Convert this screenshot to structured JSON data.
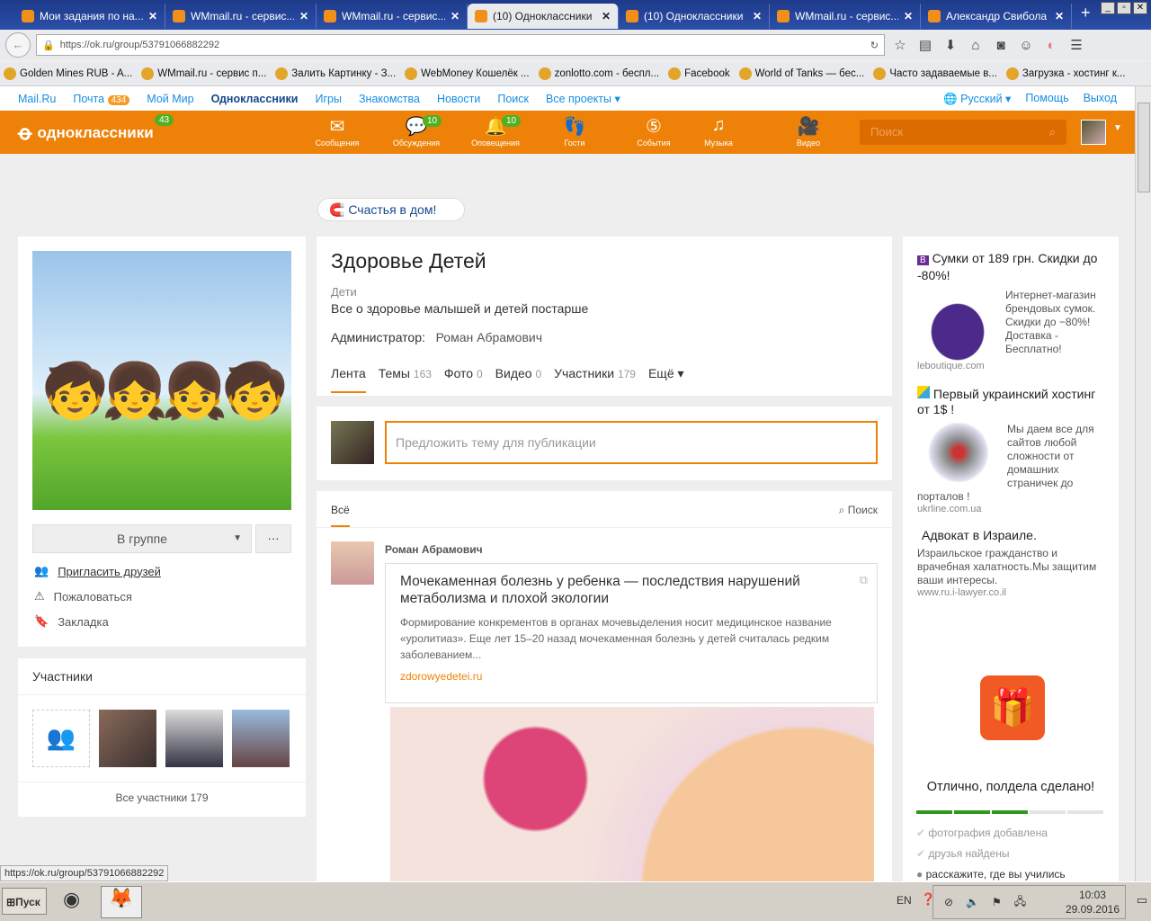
{
  "browser": {
    "tabs": [
      {
        "title": "Мои задания по на..."
      },
      {
        "title": "WMmail.ru - сервис..."
      },
      {
        "title": "WMmail.ru - сервис..."
      },
      {
        "title": "(10) Одноклассники",
        "active": true
      },
      {
        "title": "(10) Одноклассники"
      },
      {
        "title": "WMmail.ru - сервис..."
      },
      {
        "title": "Александр Свибола"
      }
    ],
    "url": "https://ok.ru/group/53791066882292",
    "bookmarks": [
      "Golden Mines RUB - A...",
      "WMmail.ru - сервис п...",
      "Залить Картинку - З...",
      "WebMoney Кошелёк ...",
      "zonlotto.com - беспл...",
      "Facebook",
      "World of Tanks — бес...",
      "Часто задаваемые в...",
      "Загрузка - хостинг к..."
    ],
    "status_url": "https://ok.ru/group/53791066882292"
  },
  "mailbar": {
    "items": [
      "Mail.Ru",
      "Почта",
      "Мой Мир",
      "Одноклассники",
      "Игры",
      "Знакомства",
      "Новости",
      "Поиск",
      "Все проекты ▾"
    ],
    "mail_count": "434",
    "lang": "Русский ▾",
    "help": "Помощь",
    "exit": "Выход"
  },
  "header": {
    "logo": "одноклассники",
    "logo_badge": "43",
    "nav": [
      {
        "label": "Сообщения",
        "icon": "envelope-icon",
        "glyph": "✉"
      },
      {
        "label": "Обсуждения",
        "icon": "chat-icon",
        "glyph": "💬",
        "badge": "10"
      },
      {
        "label": "Оповещения",
        "icon": "bell-icon",
        "glyph": "🔔",
        "badge": "10"
      },
      {
        "label": "Гости",
        "icon": "footprints-icon",
        "glyph": "👣"
      },
      {
        "label": "События",
        "icon": "events-icon",
        "glyph": "⑤"
      },
      {
        "label": "Музыка",
        "icon": "music-icon",
        "glyph": "♫"
      },
      {
        "label": "Видео",
        "icon": "video-icon",
        "glyph": "🎥"
      }
    ],
    "search_placeholder": "Поиск"
  },
  "promo": "Счастья в дом!",
  "left": {
    "group_button": "В группе",
    "more": "···",
    "actions": [
      "Пригласить друзей",
      "Пожаловаться",
      "Закладка"
    ],
    "members_title": "Участники",
    "all_members": "Все участники 179"
  },
  "group": {
    "title": "Здоровье Детей",
    "category": "Дети",
    "description": "Все о здоровье малышей и детей постарше",
    "admin_label": "Администратор:",
    "admin": "Роман Абрамович",
    "tabs": [
      {
        "label": "Лента",
        "count": ""
      },
      {
        "label": "Темы",
        "count": "163"
      },
      {
        "label": "Фото",
        "count": "0"
      },
      {
        "label": "Видео",
        "count": "0"
      },
      {
        "label": "Участники",
        "count": "179"
      },
      {
        "label": "Ещё ▾",
        "count": ""
      }
    ],
    "suggest_placeholder": "Предложить тему для публикации"
  },
  "feed": {
    "filter": "Всё",
    "search": "Поиск",
    "author": "Роман Абрамович",
    "post_title": "Мочекаменная болезнь у ребенка — последствия нарушений метаболизма и плохой экологии",
    "post_text": "Формирование конкрементов в органах мочевыделения носит медицинское название «уролитиаз». Еще лет 15–20 назад мочекаменная болезнь у детей считалась редким заболеванием...",
    "post_link": "zdorowyedetei.ru"
  },
  "ads": [
    {
      "title": "Сумки от 189 грн. Скидки до -80%!",
      "text": "Интернет-магазин брендовых сумок. Скидки до −80%! Доставка - Бесплатно!",
      "source": "leboutique.com"
    },
    {
      "title": "Первый украинский хостинг от 1$ !",
      "text": "Мы даем все для сайтов любой сложности от домашних страничек до порталов !",
      "source": "ukrline.com.ua"
    },
    {
      "title": "Адвокат в Израиле.",
      "text": "Израильское гражданство и врачебная халатность.Мы защитим ваши интересы.",
      "source": "www.ru.i-lawyer.co.il"
    }
  ],
  "profile_progress": {
    "title": "Отлично, полдела сделано!",
    "completed_steps": 3,
    "total_steps": 5,
    "steps": [
      "фотография добавлена",
      "друзья найдены",
      "расскажите, где вы учились"
    ]
  },
  "taskbar": {
    "start": "Пуск",
    "lang": "EN",
    "time": "10:03",
    "date": "29.09.2016"
  }
}
